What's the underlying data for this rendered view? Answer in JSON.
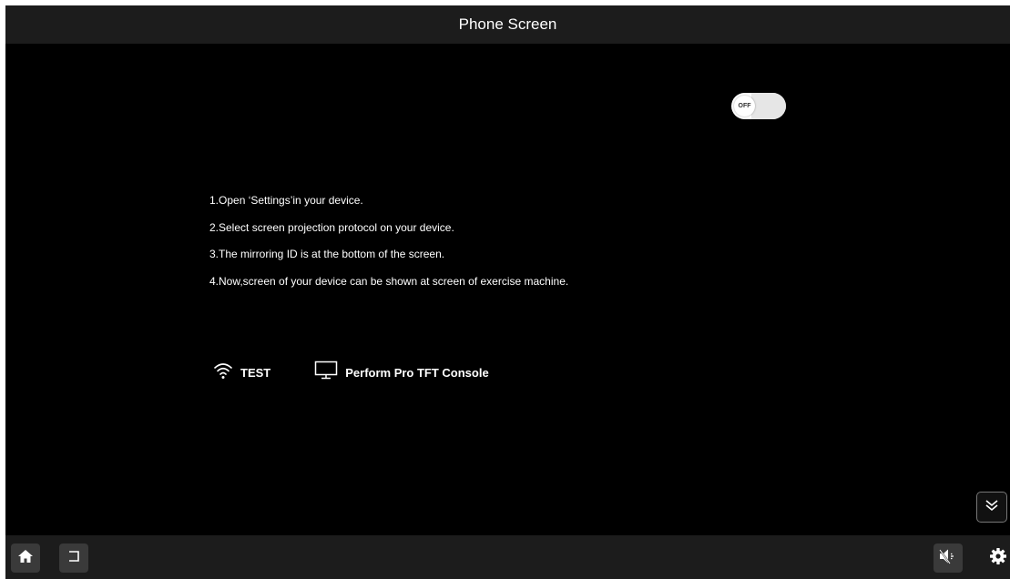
{
  "header": {
    "title": "Phone Screen"
  },
  "mirroring_toggle": {
    "state_label": "OFF",
    "is_on": false
  },
  "instructions": [
    "1.Open ‘Settings’in your device.",
    "2.Select screen projection protocol on your device.",
    "3.The mirroring ID is at the bottom of the screen.",
    "4.Now,screen of your device can be shown at screen of exercise machine."
  ],
  "status": {
    "wifi_name": "TEST",
    "device_name": "Perform Pro TFT Console"
  },
  "icons": {
    "wifi": "wifi-icon",
    "monitor": "monitor-icon",
    "collapse": "double-chevron-down-icon",
    "home": "home-icon",
    "back": "back-icon",
    "volume": "volume-mute-icon",
    "settings": "gear-icon"
  },
  "colors": {
    "background": "#000000",
    "bar": "#1c1c1c",
    "text": "#ffffff",
    "button_bg": "#3a3a3a"
  }
}
